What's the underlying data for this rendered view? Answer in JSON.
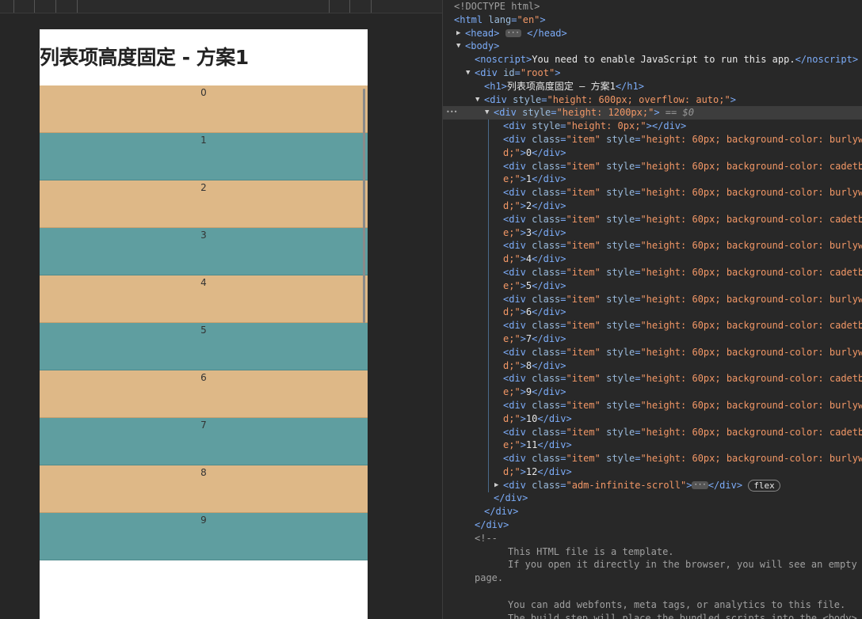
{
  "page": {
    "title": "列表项高度固定 - 方案1"
  },
  "colors": {
    "odd_item": "#deb887",
    "even_item": "#5f9ea0"
  },
  "list": {
    "items": [
      "0",
      "1",
      "2",
      "3",
      "4",
      "5",
      "6",
      "7",
      "8",
      "9"
    ]
  },
  "devtools": {
    "doctype": "<!DOCTYPE html>",
    "html_open": "<html lang=\"en\">",
    "head": "<head>",
    "head_close": "</head>",
    "body_open": "<body>",
    "noscript_open": "<noscript>",
    "noscript_text": "You need to enable JavaScript to run this app.",
    "noscript_close": "</noscript>",
    "root_open": "<div id=\"root\">",
    "h1_open": "<h1>",
    "h1_text": "列表项高度固定 – 方案1",
    "h1_close": "</h1>",
    "scroll_div_open": "<div style=\"height: 600px; overflow: auto;\">",
    "inner_div_open": "<div style=\"height: 1200px;\">",
    "selected_marker": "== $0",
    "spacer_div": "<div style=\"height: 0px;\"></div>",
    "items": [
      {
        "color": "burlywood",
        "label": "0"
      },
      {
        "color": "cadetblue",
        "label": "1"
      },
      {
        "color": "burlywood",
        "label": "2"
      },
      {
        "color": "cadetblue",
        "label": "3"
      },
      {
        "color": "burlywood",
        "label": "4"
      },
      {
        "color": "cadetblue",
        "label": "5"
      },
      {
        "color": "burlywood",
        "label": "6"
      },
      {
        "color": "cadetblue",
        "label": "7"
      },
      {
        "color": "burlywood",
        "label": "8"
      },
      {
        "color": "cadetblue",
        "label": "9"
      },
      {
        "color": "burlywood",
        "label": "10"
      },
      {
        "color": "cadetblue",
        "label": "11"
      },
      {
        "color": "burlywood",
        "label": "12"
      }
    ],
    "infinite_scroll": "<div class=\"adm-infinite-scroll\">",
    "flex_badge": "flex",
    "div_close": "</div>",
    "comment_open": "<!--",
    "comment_line1": "This HTML file is a template.",
    "comment_line2": "If you open it directly in the browser, you will see an empty",
    "comment_line3": "page.",
    "comment_line4": "You can add webfonts, meta tags, or analytics to this file.",
    "comment_line5": "The build step will place the bundled scripts into the <body>"
  }
}
